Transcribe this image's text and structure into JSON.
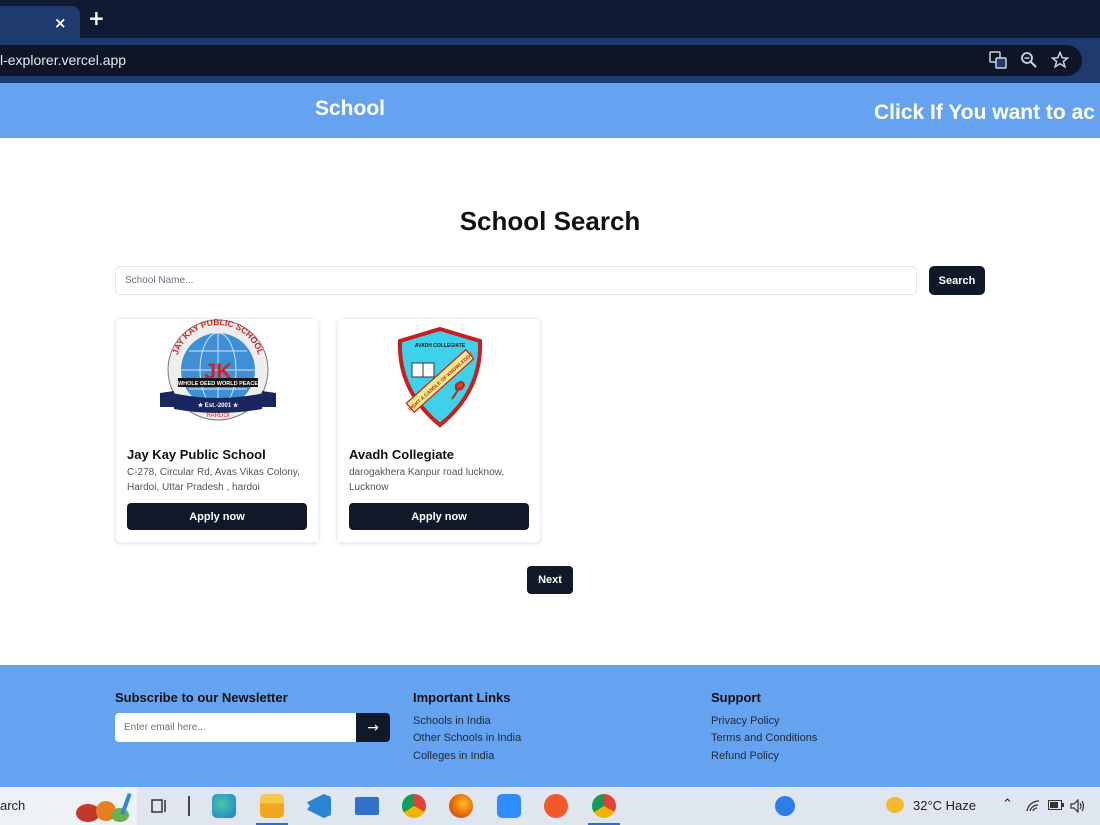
{
  "browser": {
    "url": "l-explorer.vercel.app",
    "close_glyph": "×",
    "newtab_glyph": "+"
  },
  "header": {
    "brand": "School",
    "marquee": "Click If You want to ac"
  },
  "main": {
    "title": "School Search",
    "search_placeholder": "School Name...",
    "search_button": "Search",
    "schools": [
      {
        "name": "Jay Kay Public School",
        "address": "C-278, Circular Rd, Avas Vikas Colony, Hardoi, Uttar Pradesh , hardoi",
        "apply_label": "Apply now",
        "logo": {
          "ring_text": "JAY KAY PUBLIC SCHOOL",
          "initials": "JK",
          "motto": "WHOLE DEED WORLD PEACE",
          "est": "★ Est.-2001 ★",
          "city": "HARDOI"
        }
      },
      {
        "name": "Avadh Collegiate",
        "address": "darogakhera Kanpur road lucknow, Lucknow",
        "apply_label": "Apply now",
        "logo": {
          "top_text": "AVADH COLLEGIATE",
          "ribbon_text": "LIGHT A CANDLE OF KNOWLEDGE"
        }
      }
    ],
    "next_button": "Next"
  },
  "footer": {
    "newsletter_title": "Subscribe to our Newsletter",
    "email_placeholder": "Enter email here...",
    "submit_glyph": "→",
    "links_title": "Important Links",
    "links": [
      "Schools in India",
      "Other Schools in India",
      "Colleges in India"
    ],
    "support_title": "Support",
    "support_links": [
      "Privacy Policy",
      "Terms and Conditions",
      "Refund Policy"
    ]
  },
  "taskbar": {
    "search_text": "arch",
    "weather": "32°C  Haze",
    "tray_icons": [
      "chevron-up-icon",
      "wifi-icon",
      "battery-icon",
      "speaker-icon"
    ]
  },
  "colors": {
    "accent_blue": "#65a3f0",
    "dark_button": "#111827",
    "tab_dark": "#0f1a33"
  }
}
